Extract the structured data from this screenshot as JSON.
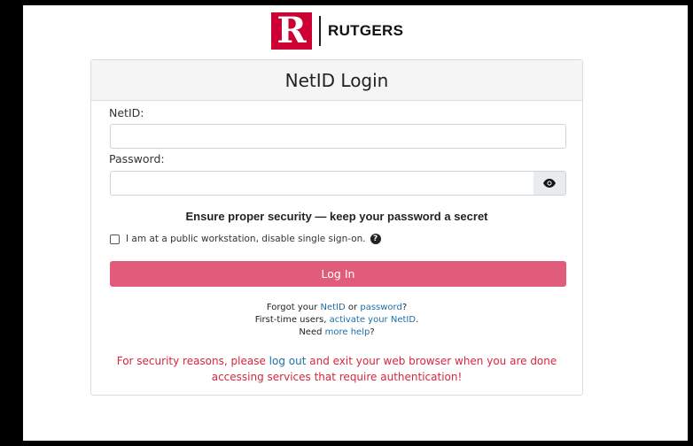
{
  "brand": {
    "logo_letter": "R",
    "name": "RUTGERS",
    "logo_color": "#cc0033"
  },
  "login": {
    "title": "NetID Login",
    "netid_label": "NetID:",
    "netid_value": "",
    "password_label": "Password:",
    "password_value": "",
    "show_password_icon": "eye-icon",
    "security_note": "Ensure proper security — keep your password a secret",
    "public_workstation_label": "I am at a public workstation, disable single sign-on.",
    "public_workstation_checked": false,
    "help_icon": "question-circle-icon",
    "login_button": "Log In",
    "login_button_color": "#e05c7a"
  },
  "help_links": {
    "forgot_prefix": "Forgot your ",
    "netid_link": "NetID",
    "or_text": " or ",
    "password_link": "password",
    "forgot_suffix": "?",
    "first_time_prefix": "First-time users, ",
    "activate_link": "activate your NetID",
    "first_time_suffix": ".",
    "need_prefix": "Need ",
    "more_help_link": "more help",
    "need_suffix": "?"
  },
  "warning": {
    "prefix": "For security reasons, please ",
    "logout_link": "log out",
    "suffix": " and exit your web browser when you are done accessing services that require authentication!",
    "color": "#d7263d"
  }
}
